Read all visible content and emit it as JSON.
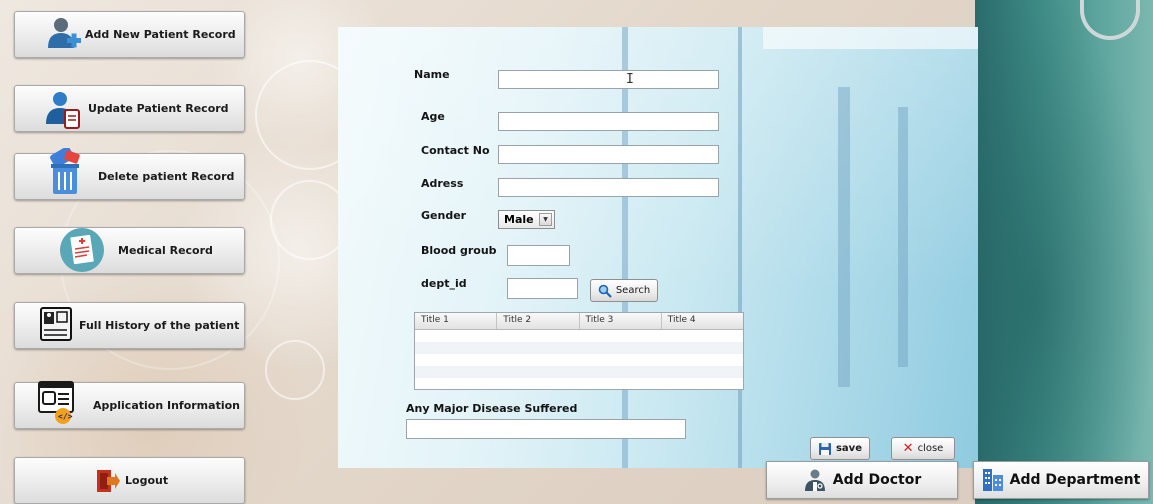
{
  "sidebar": {
    "add_new": "Add New Patient Record",
    "update": "Update Patient Record",
    "delete": "Delete patient Record",
    "medical": "Medical Record",
    "history": "Full History of the patient",
    "app_info": "Application Information",
    "logout": "Logout"
  },
  "form": {
    "name_label": "Name",
    "name_value": "",
    "age_label": "Age",
    "age_value": "",
    "contact_label": "Contact No",
    "contact_value": "",
    "address_label": "Adress",
    "address_value": "",
    "gender_label": "Gender",
    "gender_selected": "Male",
    "blood_label": "Blood groub",
    "blood_value": "",
    "dept_label": "dept_id",
    "dept_value": "",
    "search_label": "Search",
    "table_headers": [
      "Title 1",
      "Title 2",
      "Title 3",
      "Title 4"
    ],
    "disease_label": "Any Major Disease Suffered",
    "disease_value": "",
    "save_label": "save",
    "close_label": "close"
  },
  "actions": {
    "add_doctor": "Add Doctor",
    "add_department": "Add Department"
  },
  "colors": {
    "panel_tint": "#c9e8f1",
    "close_red": "#d11f1f",
    "save_blue": "#2c62b8"
  }
}
